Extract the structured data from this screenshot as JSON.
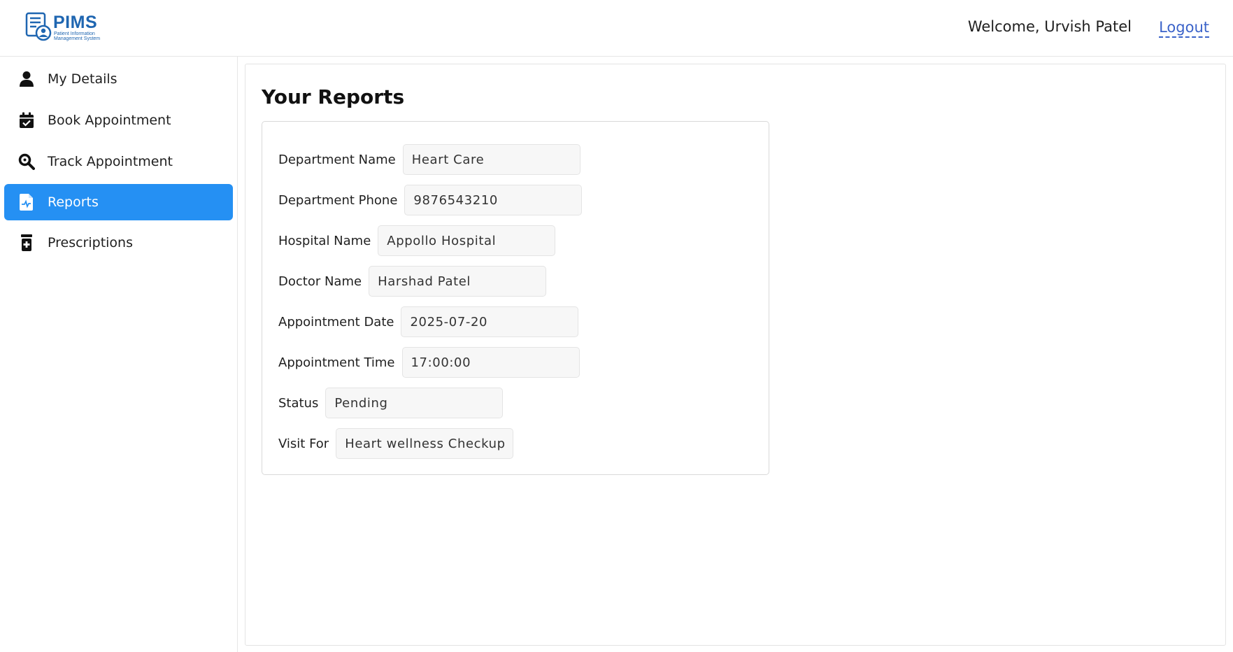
{
  "app": {
    "logo_title": "PIMS",
    "logo_subtitle": "Patient Information Management System",
    "brand_color": "#1f66b1"
  },
  "header": {
    "welcome_text": "Welcome, Urvish Patel",
    "logout_label": "Logout"
  },
  "sidebar": {
    "active_color": "#2590f3",
    "items": [
      {
        "label": "My Details",
        "icon": "user-icon"
      },
      {
        "label": "Book Appointment",
        "icon": "calendar-check-icon"
      },
      {
        "label": "Track Appointment",
        "icon": "search-icon"
      },
      {
        "label": "Reports",
        "icon": "report-file-icon",
        "active": true
      },
      {
        "label": "Prescriptions",
        "icon": "medicine-bottle-icon"
      }
    ]
  },
  "main": {
    "title": "Your Reports",
    "fields": [
      {
        "label": "Department Name",
        "value": "Heart Care"
      },
      {
        "label": "Department Phone",
        "value": "9876543210"
      },
      {
        "label": "Hospital Name",
        "value": "Appollo Hospital"
      },
      {
        "label": "Doctor Name",
        "value": "Harshad Patel"
      },
      {
        "label": "Appointment Date",
        "value": "2025-07-20"
      },
      {
        "label": "Appointment Time",
        "value": "17:00:00"
      },
      {
        "label": "Status",
        "value": "Pending"
      },
      {
        "label": "Visit For",
        "value": "Heart wellness Checkup"
      }
    ]
  }
}
